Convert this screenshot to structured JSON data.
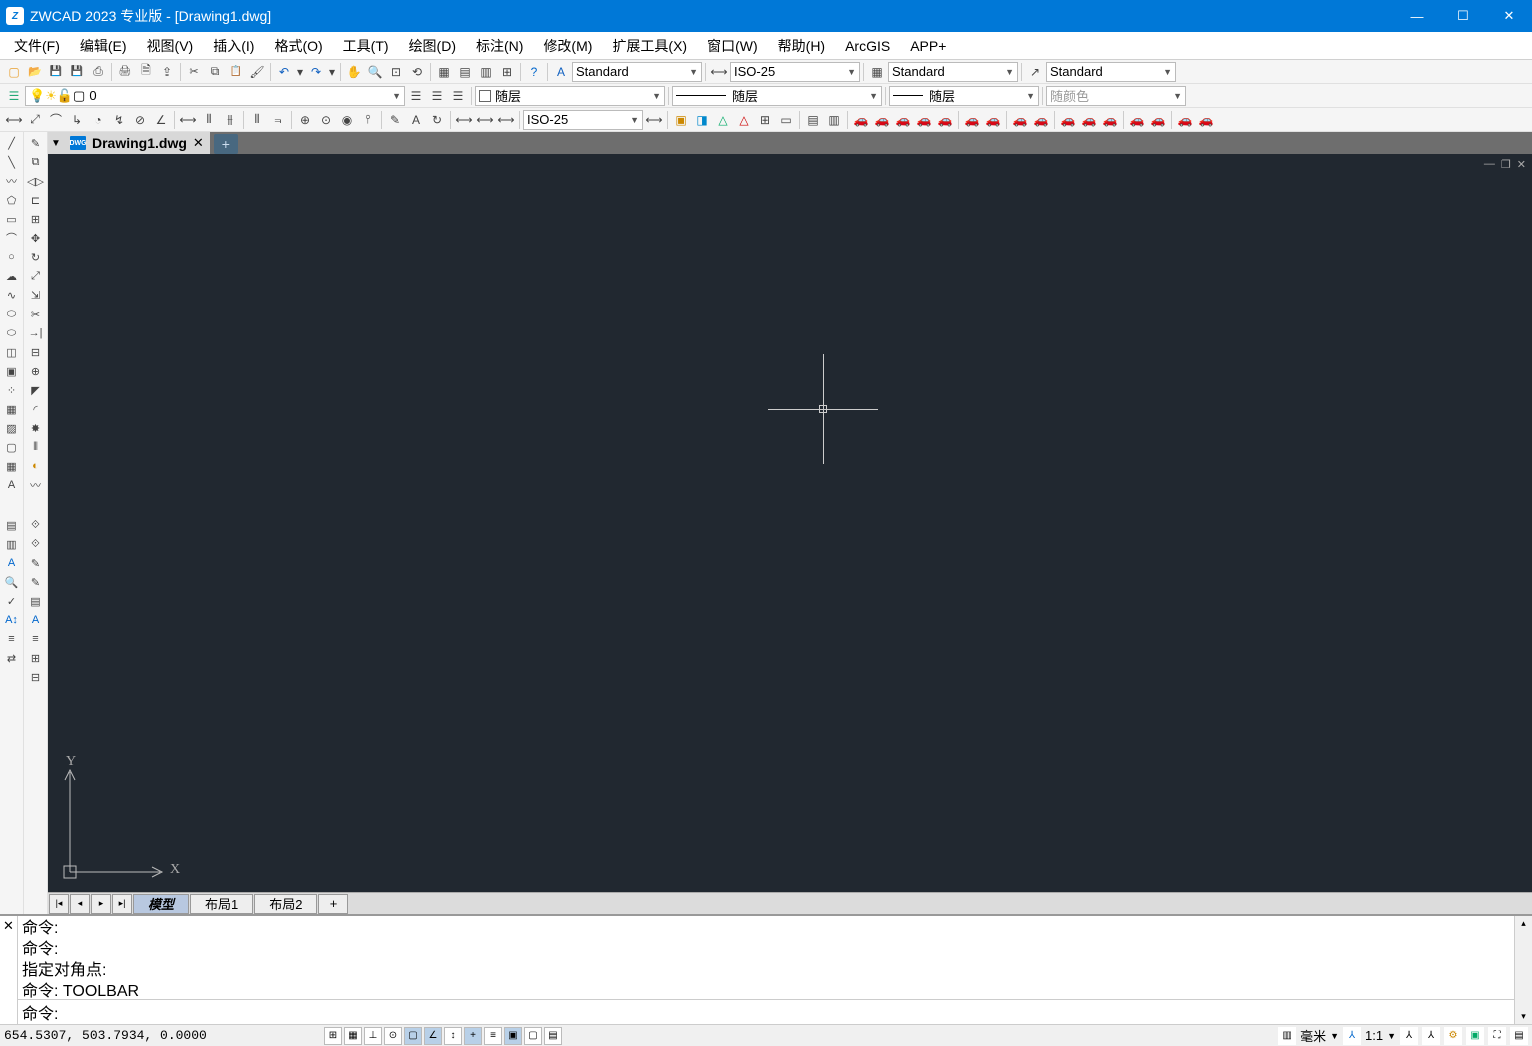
{
  "title": "ZWCAD 2023 专业版 - [Drawing1.dwg]",
  "menus": [
    "文件(F)",
    "编辑(E)",
    "视图(V)",
    "插入(I)",
    "格式(O)",
    "工具(T)",
    "绘图(D)",
    "标注(N)",
    "修改(M)",
    "扩展工具(X)",
    "窗口(W)",
    "帮助(H)",
    "ArcGIS",
    "APP+"
  ],
  "combo_text_style": "Standard",
  "combo_dim_style": "ISO-25",
  "combo_table_style": "Standard",
  "combo_mleader_style": "Standard",
  "layer_combo": "0",
  "layer_color_label": "随层",
  "linetype_label": "随层",
  "lineweight_label": "随层",
  "bycolor_label": "随颜色",
  "dim_combo": "ISO-25",
  "doc_tab": "Drawing1.dwg",
  "ucs_x": "X",
  "ucs_y": "Y",
  "layout_tabs": {
    "model": "模型",
    "layout1": "布局1",
    "layout2": "布局2"
  },
  "cmd_history": [
    "命令:",
    "命令:",
    "指定对角点:",
    "命令: TOOLBAR"
  ],
  "cmd_prompt": "命令:",
  "status_coords": "654.5307, 503.7934, 0.0000",
  "status_unit": "毫米",
  "status_scale": "1:1"
}
